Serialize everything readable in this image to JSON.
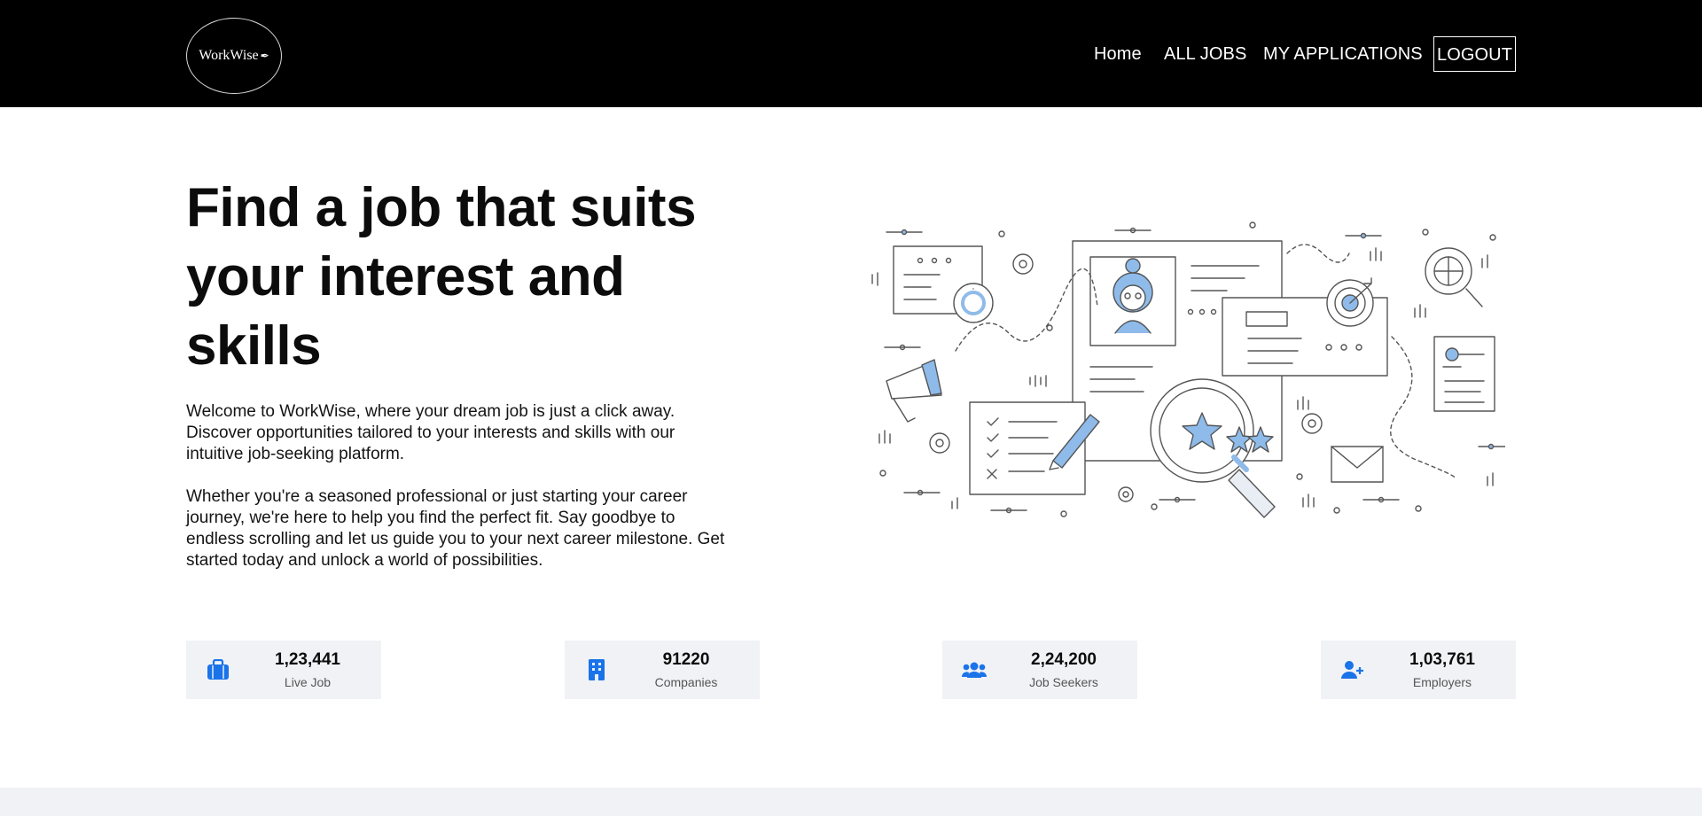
{
  "brand": {
    "name": "WorkWise",
    "logo_icon": "pen-nib-icon"
  },
  "nav": {
    "home": "Home",
    "all_jobs": "ALL JOBS",
    "my_applications": "MY APPLICATIONS",
    "logout": "LOGOUT"
  },
  "hero": {
    "title": "Find a job that suits your interest and skills",
    "paragraph1": "Welcome to WorkWise, where your dream job is just a click away. Discover opportunities tailored to your interests and skills with our intuitive job-seeking platform.",
    "paragraph2": "Whether you're a seasoned professional or just starting your career journey, we're here to help you find the perfect fit. Say goodbye to endless scrolling and let us guide you to your next career milestone. Get started today and unlock a world of possibilities."
  },
  "stats": [
    {
      "value": "1,23,441",
      "label": "Live Job",
      "icon": "briefcase-icon"
    },
    {
      "value": "91220",
      "label": "Companies",
      "icon": "building-icon"
    },
    {
      "value": "2,24,200",
      "label": "Job Seekers",
      "icon": "users-icon"
    },
    {
      "value": "1,03,761",
      "label": "Employers",
      "icon": "user-plus-icon"
    }
  ],
  "colors": {
    "accent": "#1a73e8",
    "navbar": "#000000",
    "stat_bg": "#f0f2f6",
    "illustration_fill": "#8fbbea"
  }
}
